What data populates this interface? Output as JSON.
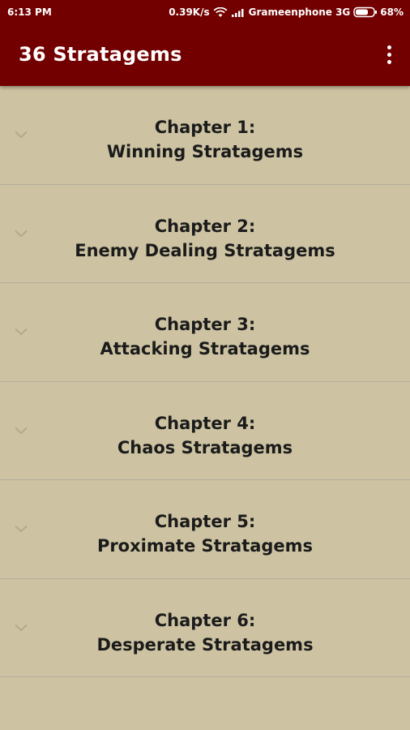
{
  "status_bar": {
    "time": "6:13 PM",
    "speed": "0.39K/s",
    "carrier": "Grameenphone 3G",
    "battery": "68%"
  },
  "toolbar": {
    "title": "36 Stratagems",
    "overflow_icon": "more-vert-icon"
  },
  "chapters": [
    {
      "heading": "Chapter 1:",
      "title": "Winning Stratagems"
    },
    {
      "heading": "Chapter 2:",
      "title": "Enemy Dealing Stratagems"
    },
    {
      "heading": "Chapter 3:",
      "title": "Attacking Stratagems"
    },
    {
      "heading": "Chapter 4:",
      "title": "Chaos Stratagems"
    },
    {
      "heading": "Chapter 5:",
      "title": "Proximate Stratagems"
    },
    {
      "heading": "Chapter 6:",
      "title": "Desperate Stratagems"
    }
  ],
  "colors": {
    "app_bar": "#730000",
    "background": "#cdc3a2",
    "divider": "#b3ad9c",
    "text": "#1b1b1b"
  }
}
